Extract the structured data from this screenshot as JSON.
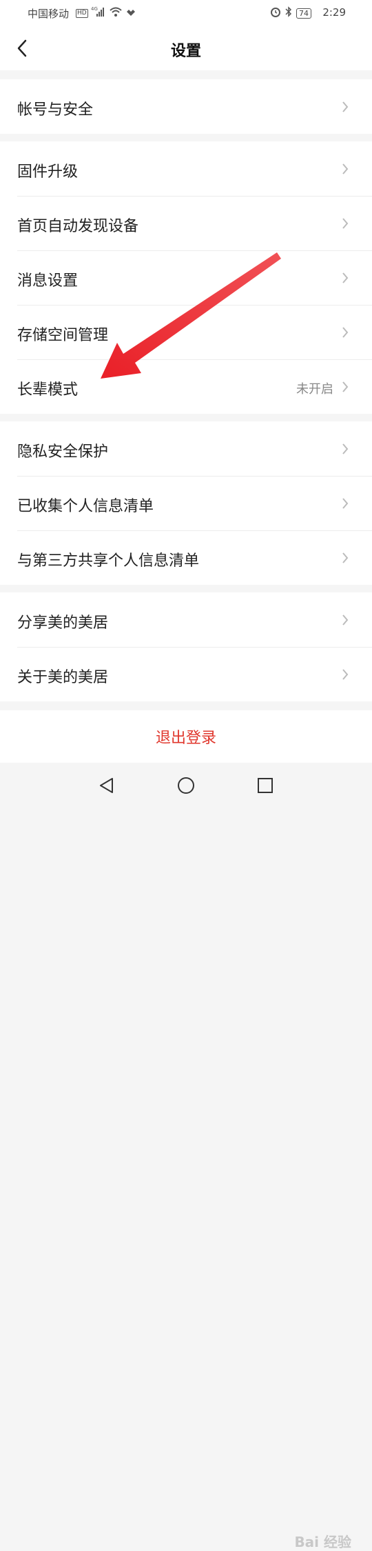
{
  "status_bar": {
    "carrier": "中国移动",
    "hd": "HD",
    "network": "4G",
    "battery": "74",
    "time": "2:29"
  },
  "header": {
    "title": "设置"
  },
  "groups": [
    {
      "items": [
        {
          "label": "帐号与安全"
        }
      ]
    },
    {
      "items": [
        {
          "label": "固件升级"
        },
        {
          "label": "首页自动发现设备"
        },
        {
          "label": "消息设置"
        },
        {
          "label": "存储空间管理"
        },
        {
          "label": "长辈模式",
          "value": "未开启"
        }
      ]
    },
    {
      "items": [
        {
          "label": "隐私安全保护"
        },
        {
          "label": "已收集个人信息清单"
        },
        {
          "label": "与第三方共享个人信息清单"
        }
      ]
    },
    {
      "items": [
        {
          "label": "分享美的美居"
        },
        {
          "label": "关于美的美居"
        }
      ]
    }
  ],
  "logout": {
    "label": "退出登录"
  },
  "colors": {
    "accent_red": "#e0372d",
    "annotation_arrow": "#e8141c"
  },
  "watermark": "Bai 经验"
}
